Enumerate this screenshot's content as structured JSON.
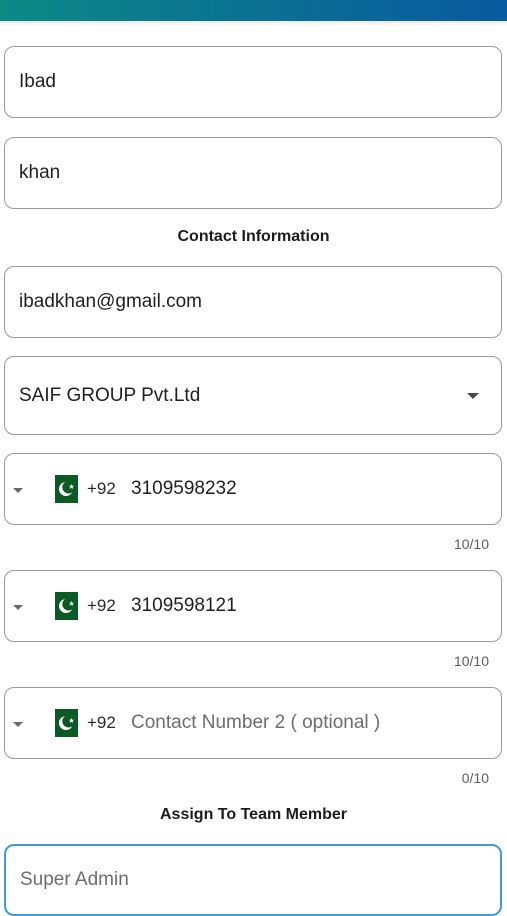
{
  "first_name": {
    "value": "Ibad"
  },
  "last_name": {
    "value": "khan"
  },
  "contact_section": {
    "title": "Contact Information"
  },
  "email": {
    "value": "ibadkhan@gmail.com"
  },
  "company": {
    "selected": "SAIF GROUP Pvt.Ltd"
  },
  "phone_primary": {
    "country_code": "+92",
    "value": "3109598232",
    "counter": "10/10",
    "flag": "pakistan-flag-icon"
  },
  "phone_1": {
    "country_code": "+92",
    "value": "3109598121",
    "counter": "10/10",
    "flag": "pakistan-flag-icon"
  },
  "phone_2": {
    "country_code": "+92",
    "placeholder": "Contact Number 2 ( optional )",
    "counter": "0/10",
    "flag": "pakistan-flag-icon"
  },
  "assign_section": {
    "title": "Assign To Team Member"
  },
  "team_member": {
    "placeholder": "Super Admin"
  },
  "colors": {
    "header_start": "#0c8a86",
    "header_end": "#0a5aa0",
    "focus_border": "#3d9be3",
    "flag_green": "#0b5a26"
  }
}
